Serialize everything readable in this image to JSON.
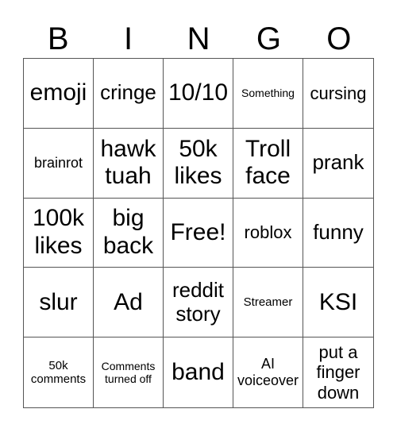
{
  "header": [
    "B",
    "I",
    "N",
    "G",
    "O"
  ],
  "cells": [
    "emoji",
    "cringe",
    "10/10",
    "Something",
    "cursing",
    "brainrot",
    "hawk tuah",
    "50k likes",
    "Troll face",
    "prank",
    "100k likes",
    "big back",
    "Free!",
    "roblox",
    "funny",
    "slur",
    "Ad",
    "reddit story",
    "Streamer",
    "KSI",
    "50k comments",
    "Comments turned off",
    "band",
    "AI voiceover",
    "put a finger down"
  ]
}
